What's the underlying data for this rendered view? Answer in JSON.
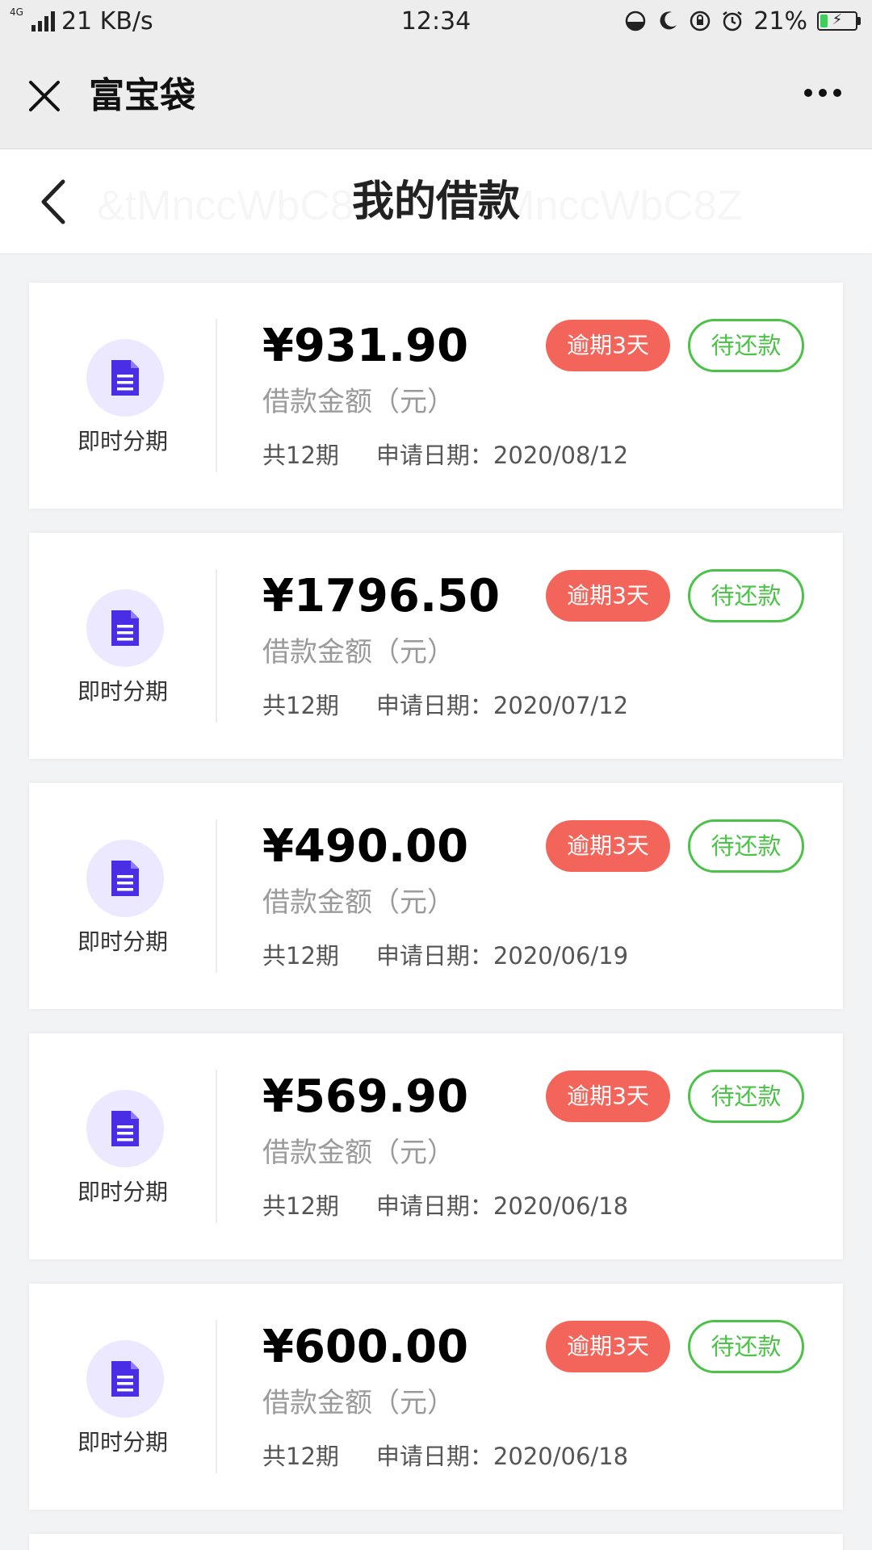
{
  "status_bar": {
    "network": "4G",
    "speed": "21 KB/s",
    "time": "12:34",
    "battery": "21%",
    "battery_level": 0.21
  },
  "header": {
    "title": "富宝袋"
  },
  "page": {
    "title": "我的借款"
  },
  "watermark_text": "&tMnccWbC8Z",
  "loans": [
    {
      "product": "即时分期",
      "amount": "¥931.90",
      "amount_label": "借款金额（元）",
      "periods": "共12期",
      "date_label": "申请日期：",
      "date": "2020/08/12",
      "overdue": "逾期3天",
      "action": "待还款"
    },
    {
      "product": "即时分期",
      "amount": "¥1796.50",
      "amount_label": "借款金额（元）",
      "periods": "共12期",
      "date_label": "申请日期：",
      "date": "2020/07/12",
      "overdue": "逾期3天",
      "action": "待还款"
    },
    {
      "product": "即时分期",
      "amount": "¥490.00",
      "amount_label": "借款金额（元）",
      "periods": "共12期",
      "date_label": "申请日期：",
      "date": "2020/06/19",
      "overdue": "逾期3天",
      "action": "待还款"
    },
    {
      "product": "即时分期",
      "amount": "¥569.90",
      "amount_label": "借款金额（元）",
      "periods": "共12期",
      "date_label": "申请日期：",
      "date": "2020/06/18",
      "overdue": "逾期3天",
      "action": "待还款"
    },
    {
      "product": "即时分期",
      "amount": "¥600.00",
      "amount_label": "借款金额（元）",
      "periods": "共12期",
      "date_label": "申请日期：",
      "date": "2020/06/18",
      "overdue": "逾期3天",
      "action": "待还款"
    }
  ],
  "colors": {
    "overdue_badge": "#f3645a",
    "pay_button": "#4cc248",
    "icon_bg": "#ebe8ff",
    "icon_fg": "#4a2ee6"
  }
}
